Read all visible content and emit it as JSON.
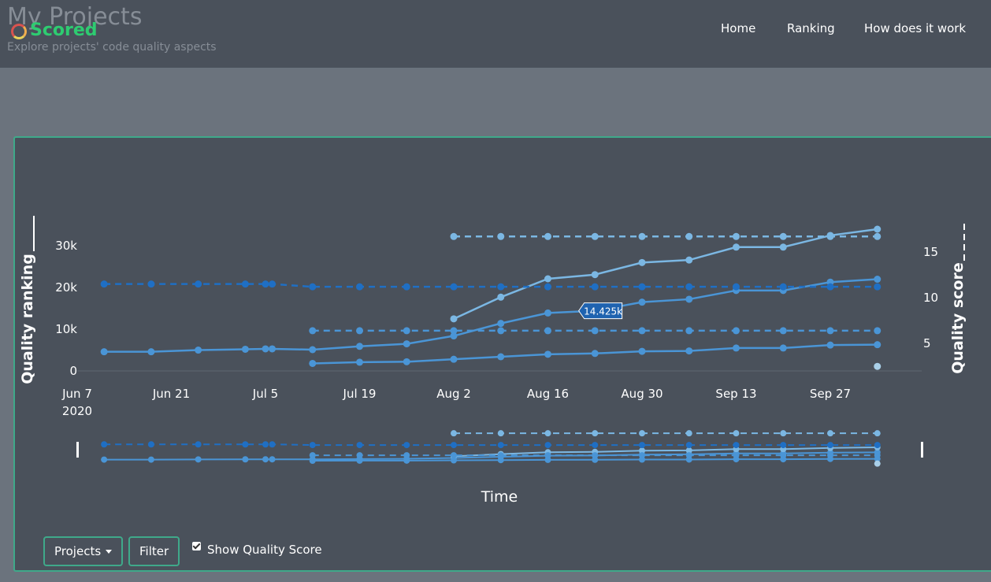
{
  "header": {
    "title": "My Projects",
    "subtitle": "Explore projects' code quality aspects",
    "logo_text": "Scored",
    "nav": [
      {
        "label": "Home"
      },
      {
        "label": "Ranking"
      },
      {
        "label": "How does it work"
      }
    ]
  },
  "controls": {
    "projects_label": "Projects",
    "filter_label": "Filter",
    "show_quality_label": "Show Quality Score",
    "show_quality_checked": true
  },
  "colors": {
    "accent": "#3fa98a",
    "series_dark": "#1f6fc4",
    "series_mid": "#4a95d6",
    "series_light": "#7bb7e3",
    "series_pale": "#a9cfe8"
  },
  "chart_data": {
    "type": "line",
    "xlabel": "Time",
    "ylabel_left": "Quality ranking",
    "ylabel_right": "Quality score",
    "x_ticks": [
      "Jun 7\n2020",
      "Jun 21",
      "Jul 5",
      "Jul 19",
      "Aug 2",
      "Aug 16",
      "Aug 30",
      "Sep 13",
      "Sep 27"
    ],
    "y_left_ticks": [
      "0",
      "10k",
      "20k",
      "30k"
    ],
    "y_left_range": [
      0,
      34000
    ],
    "y_right_ticks": [
      "5",
      "10",
      "15"
    ],
    "y_right_range": [
      2,
      17.5
    ],
    "tooltip": {
      "x": "Aug 20",
      "value": "14.425k"
    },
    "series": [
      {
        "axis": "left",
        "style": "solid",
        "color": "#4a95d6",
        "points": [
          [
            "Jun 11",
            4600
          ],
          [
            "Jun 18",
            4600
          ],
          [
            "Jun 25",
            5000
          ],
          [
            "Jul 2",
            5200
          ],
          [
            "Jul 5",
            5300
          ],
          [
            "Jul 6",
            5300
          ],
          [
            "Jul 12",
            5100
          ],
          [
            "Jul 19",
            5900
          ],
          [
            "Jul 26",
            6500
          ],
          [
            "Aug 2",
            8400
          ],
          [
            "Aug 9",
            11400
          ],
          [
            "Aug 16",
            13900
          ],
          [
            "Aug 23",
            14425
          ],
          [
            "Aug 30",
            16500
          ],
          [
            "Sep 6",
            17200
          ],
          [
            "Sep 13",
            19300
          ],
          [
            "Sep 20",
            19300
          ],
          [
            "Sep 27",
            21300
          ],
          [
            "Oct 4",
            22000
          ]
        ]
      },
      {
        "axis": "left",
        "style": "solid",
        "color": "#7bb7e3",
        "points": [
          [
            "Aug 2",
            12500
          ],
          [
            "Aug 9",
            17700
          ],
          [
            "Aug 16",
            22100
          ],
          [
            "Aug 23",
            23100
          ],
          [
            "Aug 30",
            26000
          ],
          [
            "Sep 6",
            26600
          ],
          [
            "Sep 13",
            29700
          ],
          [
            "Sep 20",
            29700
          ],
          [
            "Sep 27",
            32500
          ],
          [
            "Oct 4",
            34000
          ]
        ]
      },
      {
        "axis": "left",
        "style": "solid",
        "color": "#4a95d6",
        "points": [
          [
            "Jul 12",
            1800
          ],
          [
            "Jul 19",
            2100
          ],
          [
            "Jul 26",
            2200
          ],
          [
            "Aug 2",
            2800
          ],
          [
            "Aug 9",
            3400
          ],
          [
            "Aug 16",
            4000
          ],
          [
            "Aug 23",
            4200
          ],
          [
            "Aug 30",
            4700
          ],
          [
            "Sep 6",
            4800
          ],
          [
            "Sep 13",
            5500
          ],
          [
            "Sep 20",
            5500
          ],
          [
            "Sep 27",
            6200
          ],
          [
            "Oct 4",
            6300
          ]
        ]
      },
      {
        "axis": "right",
        "style": "dashed",
        "color": "#1f6fc4",
        "points": [
          [
            "Jun 11",
            11.5
          ],
          [
            "Jun 18",
            11.5
          ],
          [
            "Jun 25",
            11.5
          ],
          [
            "Jul 2",
            11.5
          ],
          [
            "Jul 5",
            11.5
          ],
          [
            "Jul 6",
            11.5
          ],
          [
            "Jul 12",
            11.2
          ],
          [
            "Jul 19",
            11.2
          ],
          [
            "Jul 26",
            11.2
          ],
          [
            "Aug 2",
            11.2
          ],
          [
            "Aug 9",
            11.2
          ],
          [
            "Aug 16",
            11.2
          ],
          [
            "Aug 23",
            11.2
          ],
          [
            "Aug 30",
            11.2
          ],
          [
            "Sep 6",
            11.2
          ],
          [
            "Sep 13",
            11.2
          ],
          [
            "Sep 20",
            11.2
          ],
          [
            "Sep 27",
            11.2
          ],
          [
            "Oct 4",
            11.2
          ]
        ]
      },
      {
        "axis": "right",
        "style": "dashed",
        "color": "#4a95d6",
        "points": [
          [
            "Jul 12",
            6.4
          ],
          [
            "Jul 19",
            6.4
          ],
          [
            "Jul 26",
            6.4
          ],
          [
            "Aug 2",
            6.4
          ],
          [
            "Aug 9",
            6.4
          ],
          [
            "Aug 16",
            6.4
          ],
          [
            "Aug 23",
            6.4
          ],
          [
            "Aug 30",
            6.4
          ],
          [
            "Sep 6",
            6.4
          ],
          [
            "Sep 13",
            6.4
          ],
          [
            "Sep 20",
            6.4
          ],
          [
            "Sep 27",
            6.4
          ],
          [
            "Oct 4",
            6.4
          ]
        ]
      },
      {
        "axis": "right",
        "style": "dashed",
        "color": "#7bb7e3",
        "points": [
          [
            "Aug 2",
            16.7
          ],
          [
            "Aug 9",
            16.7
          ],
          [
            "Aug 16",
            16.7
          ],
          [
            "Aug 23",
            16.7
          ],
          [
            "Aug 30",
            16.7
          ],
          [
            "Sep 6",
            16.7
          ],
          [
            "Sep 13",
            16.7
          ],
          [
            "Sep 20",
            16.7
          ],
          [
            "Sep 27",
            16.7
          ],
          [
            "Oct 4",
            16.7
          ]
        ]
      },
      {
        "axis": "right",
        "style": "marker",
        "color": "#a9cfe8",
        "points": [
          [
            "Oct 4",
            2.5
          ]
        ]
      }
    ]
  }
}
